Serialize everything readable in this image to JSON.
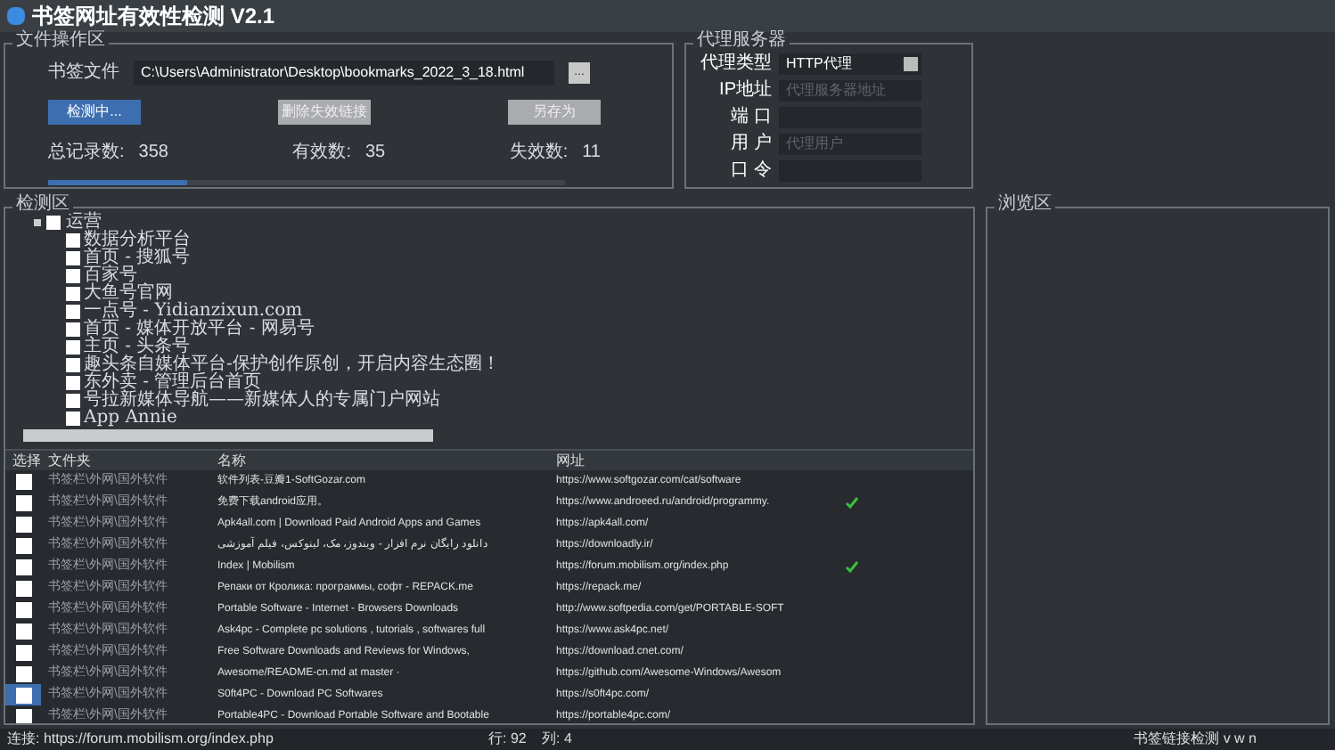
{
  "window": {
    "title": "书签网址有效性检测 V2.1"
  },
  "file_panel": {
    "title": "文件操作区",
    "file_label": "书签文件",
    "file_path": "C:\\Users\\Administrator\\Desktop\\bookmarks_2022_3_18.html",
    "browse_button": "...",
    "buttons": [
      {
        "label": "检测中...",
        "primary": true
      },
      {
        "label": "删除失效链接",
        "primary": false
      },
      {
        "label": "另存为",
        "primary": false
      }
    ],
    "stats": [
      {
        "label": "总记录数:",
        "value": "358"
      },
      {
        "label": "有效数:",
        "value": "35"
      },
      {
        "label": "失效数:",
        "value": "11"
      }
    ],
    "progress": {
      "level": 0.27
    }
  },
  "proxy_panel": {
    "title": "代理服务器",
    "fields": [
      {
        "label": "代理类型",
        "kind": "select",
        "value": "HTTP代理"
      },
      {
        "label": "IP地址",
        "kind": "input",
        "placeholder": "代理服务器地址"
      },
      {
        "label": "端 口",
        "kind": "input"
      },
      {
        "label": "用 户",
        "kind": "input",
        "placeholder": "代理用户"
      },
      {
        "label": "口 令",
        "kind": "input"
      }
    ]
  },
  "detect_panel": {
    "title": "检测区",
    "tree": [
      {
        "label": "运营",
        "expanded": true,
        "checked": false,
        "children": [
          {
            "label": "数据分析平台",
            "checked": false
          },
          {
            "label": "首页 - 搜狐号",
            "checked": false
          },
          {
            "label": "百家号",
            "checked": false
          },
          {
            "label": "大鱼号官网",
            "checked": false
          },
          {
            "label": "一点号 - Yidianzixun.com",
            "checked": false
          },
          {
            "label": "首页 - 媒体开放平台 - 网易号",
            "checked": false
          },
          {
            "label": "主页 - 头条号",
            "checked": false
          },
          {
            "label": "趣头条自媒体平台-保护创作原创，开启内容生态圈！",
            "checked": false
          },
          {
            "label": "东外卖 - 管理后台首页",
            "checked": false
          },
          {
            "label": "号拉新媒体导航——新媒体人的专属门户网站",
            "checked": false
          },
          {
            "label": "App Annie",
            "checked": false
          }
        ]
      }
    ],
    "columns": [
      "选择",
      "文件夹",
      "名称",
      "网址"
    ],
    "rows": [
      {
        "checked": false,
        "selected": false,
        "folder": "书签栏\\外网\\国外软件",
        "name": "软件列表-豆瓣1-SoftGozar.com",
        "url": "https://www.softgozar.com/cat/software",
        "valid": false
      },
      {
        "checked": false,
        "selected": false,
        "folder": "书签栏\\外网\\国外软件",
        "name": "免费下载android应用。",
        "url": "https://www.androeed.ru/android/programmy.",
        "valid": true
      },
      {
        "checked": false,
        "selected": false,
        "folder": "书签栏\\外网\\国外软件",
        "name": "Apk4all.com | Download Paid Android Apps and Games",
        "url": "https://apk4all.com/",
        "valid": false
      },
      {
        "checked": false,
        "selected": false,
        "folder": "书签栏\\外网\\国外软件",
        "name": "دانلود رایگان نرم افزار - ویندوز، مک، لینوکس، فیلم آموزشی",
        "url": "https://downloadly.ir/",
        "valid": false
      },
      {
        "checked": false,
        "selected": false,
        "folder": "书签栏\\外网\\国外软件",
        "name": "Index | Mobilism",
        "url": "https://forum.mobilism.org/index.php",
        "valid": true
      },
      {
        "checked": false,
        "selected": false,
        "folder": "书签栏\\外网\\国外软件",
        "name": "Репаки от Кролика: программы, софт - REPACK.me",
        "url": "https://repack.me/",
        "valid": false
      },
      {
        "checked": false,
        "selected": false,
        "folder": "书签栏\\外网\\国外软件",
        "name": "Portable Software - Internet - Browsers Downloads",
        "url": "http://www.softpedia.com/get/PORTABLE-SOFT",
        "valid": false
      },
      {
        "checked": false,
        "selected": false,
        "folder": "书签栏\\外网\\国外软件",
        "name": "Ask4pc - Complete pc solutions , tutorials , softwares full",
        "url": "https://www.ask4pc.net/",
        "valid": false
      },
      {
        "checked": false,
        "selected": false,
        "folder": "书签栏\\外网\\国外软件",
        "name": "Free Software Downloads and Reviews for Windows,",
        "url": "https://download.cnet.com/",
        "valid": false
      },
      {
        "checked": false,
        "selected": false,
        "folder": "书签栏\\外网\\国外软件",
        "name": "Awesome/README-cn.md at master ·",
        "url": "https://github.com/Awesome-Windows/Awesom",
        "valid": false
      },
      {
        "checked": false,
        "selected": true,
        "folder": "书签栏\\外网\\国外软件",
        "name": "S0ft4PC - Download PC Softwares",
        "url": "https://s0ft4pc.com/",
        "valid": false
      },
      {
        "checked": false,
        "selected": false,
        "folder": "书签栏\\外网\\国外软件",
        "name": "Portable4PC - Download Portable Software and Bootable",
        "url": "https://portable4pc.com/",
        "valid": false
      }
    ]
  },
  "browse_panel": {
    "title": "浏览区"
  },
  "status_bar": {
    "url": "连接: https://forum.mobilism.org/index.php",
    "row": "行: 92",
    "col": "列: 4",
    "right": "书签链接检测 v w n"
  }
}
